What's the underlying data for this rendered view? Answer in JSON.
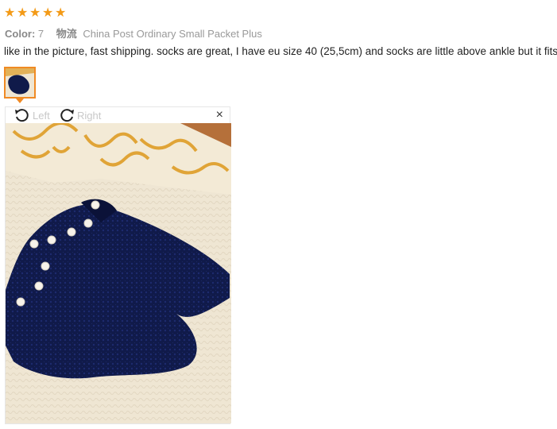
{
  "review": {
    "rating": 5,
    "color_label": "Color:",
    "color_value": "7",
    "shipping_label": "物流",
    "shipping_value": "China Post Ordinary Small Packet Plus",
    "comment": "like in the picture, fast shipping. socks are great, I have eu size 40 (25,5cm) and socks are little above ankle but it fits"
  },
  "viewer": {
    "rotate_left_label": "Left",
    "rotate_right_label": "Right",
    "close_symbol": "×"
  },
  "colors": {
    "star": "#f39a17",
    "thumb_border": "#f08a24",
    "sock": "#101a4a",
    "fur": "#efe6d3"
  }
}
